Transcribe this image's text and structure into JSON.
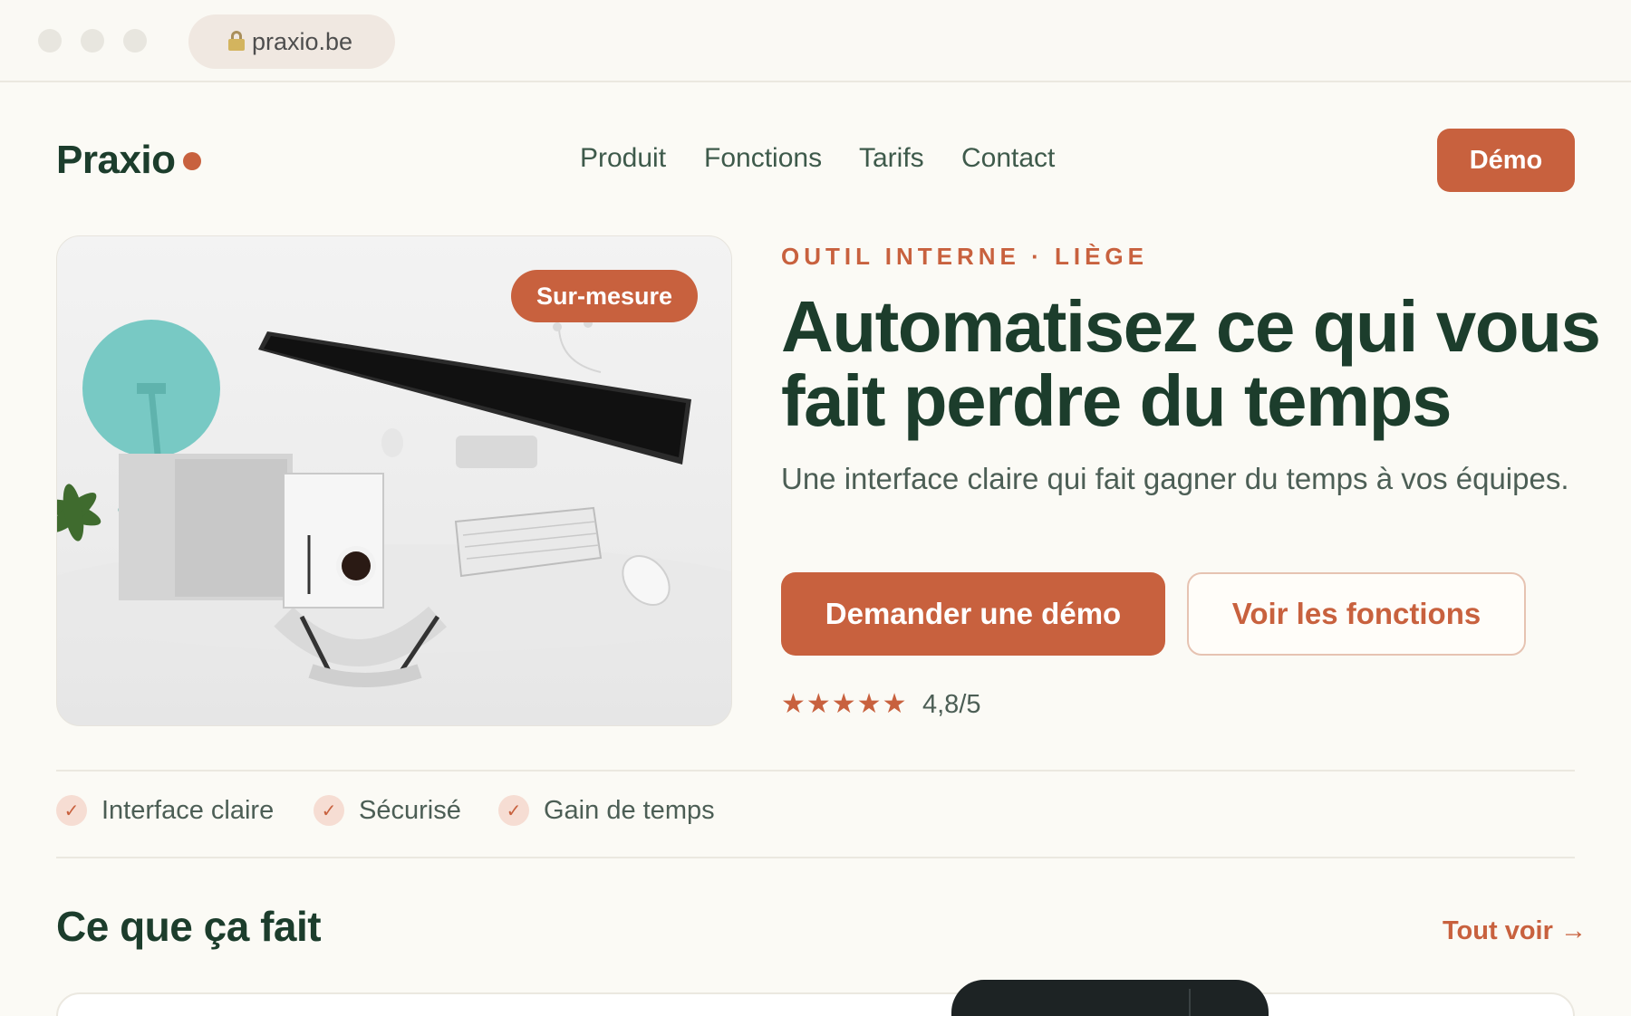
{
  "browser": {
    "url": "praxio.be"
  },
  "nav": {
    "logo": "Praxio",
    "links": [
      "Produit",
      "Fonctions",
      "Tarifs",
      "Contact"
    ],
    "cta": "Démo"
  },
  "hero": {
    "badge": "Sur-mesure",
    "eyebrow": "OUTIL INTERNE · LIÈGE",
    "headline": "Automatisez ce qui vous fait perdre du temps",
    "subtitle": "Une interface claire qui fait gagner du temps à vos équipes.",
    "primary_cta": "Demander une démo",
    "secondary_cta": "Voir les fonctions",
    "stars": "★★★★★",
    "rating": "4,8/5"
  },
  "features": [
    "Interface claire",
    "Sécurisé",
    "Gain de temps"
  ],
  "section": {
    "title": "Ce que ça fait",
    "see_all": "Tout voir →"
  },
  "colors": {
    "accent": "#c8613e",
    "dark_green": "#1c3d2c",
    "background": "#fbfaf5"
  }
}
